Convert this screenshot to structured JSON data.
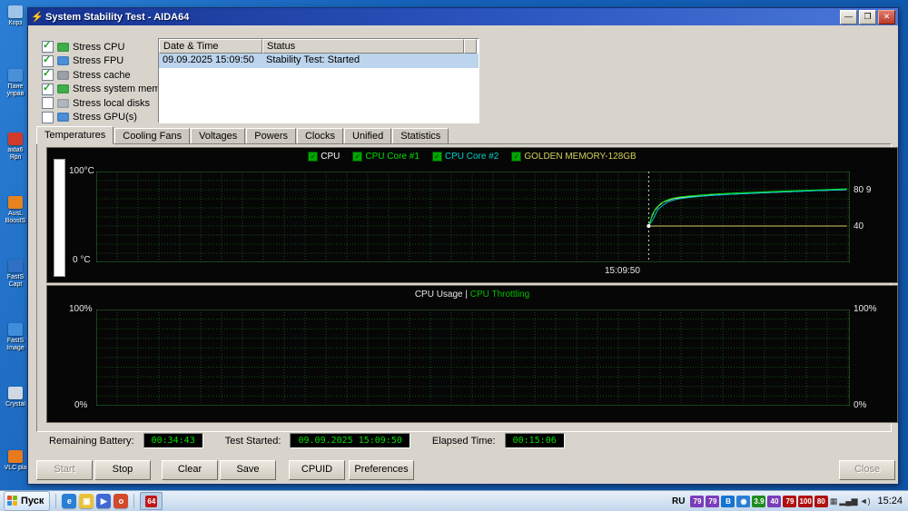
{
  "desktop": {
    "icons": [
      {
        "label": "Корз",
        "color": "#9ec4e8"
      },
      {
        "label": "Пане управ",
        "color": "#4a90d9"
      },
      {
        "label": "aida6 Ярл",
        "color": "#d23a2a"
      },
      {
        "label": "AusL BoostS",
        "color": "#e8821e"
      },
      {
        "label": "FastS Capt",
        "color": "#2f6fc4"
      },
      {
        "label": "FastS Image",
        "color": "#3f8edc"
      },
      {
        "label": "Crystal",
        "color": "#cfd8e4"
      },
      {
        "label": "VLC pla",
        "color": "#e87a1e"
      }
    ]
  },
  "window": {
    "title": "System Stability Test - AIDA64",
    "title_icon": "⚡",
    "minimize": "—",
    "maximize": "❐",
    "close": "✕"
  },
  "stress_options": [
    {
      "label": "Stress CPU",
      "checked": true,
      "icon": "cpu-icon",
      "icon_color": "#3fae49"
    },
    {
      "label": "Stress FPU",
      "checked": true,
      "icon": "fpu-icon",
      "icon_color": "#4a90d9"
    },
    {
      "label": "Stress cache",
      "checked": true,
      "icon": "cache-icon",
      "icon_color": "#9aa0a6"
    },
    {
      "label": "Stress system memory",
      "checked": true,
      "icon": "memory-icon",
      "icon_color": "#3fae49"
    },
    {
      "label": "Stress local disks",
      "checked": false,
      "icon": "disk-icon",
      "icon_color": "#b0b6bc"
    },
    {
      "label": "Stress GPU(s)",
      "checked": false,
      "icon": "gpu-icon",
      "icon_color": "#4a90d9"
    }
  ],
  "event_table": {
    "columns": [
      "Date & Time",
      "Status"
    ],
    "rows": [
      {
        "datetime": "09.09.2025 15:09:50",
        "status": "Stability Test: Started",
        "selected": true
      }
    ]
  },
  "tabs": [
    {
      "label": "Temperatures",
      "active": true
    },
    {
      "label": "Cooling Fans",
      "active": false
    },
    {
      "label": "Voltages",
      "active": false
    },
    {
      "label": "Powers",
      "active": false
    },
    {
      "label": "Clocks",
      "active": false
    },
    {
      "label": "Unified",
      "active": false
    },
    {
      "label": "Statistics",
      "active": false
    }
  ],
  "temperature_chart": {
    "y_top_label": "100°C",
    "y_bottom_label": "0 °C",
    "x_tick_label": "15:09:50",
    "right_labels": [
      {
        "text": "80 9",
        "value": 80
      },
      {
        "text": "40",
        "value": 40
      }
    ],
    "legend": [
      {
        "label": "CPU",
        "color": "#ffffff"
      },
      {
        "label": "CPU Core #1",
        "color": "#00e000"
      },
      {
        "label": "CPU Core #2",
        "color": "#00d2c8"
      },
      {
        "label": "GOLDEN MEMORY-128GB",
        "color": "#d2d25a"
      }
    ],
    "chart_data": {
      "type": "line",
      "ylim": [
        0,
        100
      ],
      "test_start_fraction": 0.733,
      "series": [
        {
          "name": "CPU",
          "color": "#e8e8e8",
          "points": [
            [
              0.733,
              40
            ],
            [
              0.737,
              50
            ],
            [
              0.741,
              57
            ],
            [
              0.746,
              62
            ],
            [
              0.752,
              66
            ],
            [
              0.758,
              68
            ],
            [
              0.765,
              70
            ],
            [
              0.773,
              71
            ],
            [
              0.782,
              72
            ],
            [
              0.792,
              72.5
            ],
            [
              0.803,
              73
            ],
            [
              0.815,
              74
            ],
            [
              0.828,
              74.5
            ],
            [
              0.842,
              75
            ],
            [
              0.856,
              75.5
            ],
            [
              0.87,
              76
            ],
            [
              0.884,
              76.5
            ],
            [
              0.898,
              77
            ],
            [
              0.912,
              77.5
            ],
            [
              0.926,
              78
            ],
            [
              0.94,
              78.5
            ],
            [
              0.954,
              79
            ],
            [
              0.968,
              79.3
            ],
            [
              0.982,
              79.6
            ],
            [
              0.996,
              80
            ]
          ]
        },
        {
          "name": "CPU Core #1",
          "color": "#00dc00",
          "points": [
            [
              0.733,
              40
            ],
            [
              0.738,
              53
            ],
            [
              0.743,
              60
            ],
            [
              0.749,
              65
            ],
            [
              0.756,
              68
            ],
            [
              0.764,
              70.5
            ],
            [
              0.774,
              72
            ],
            [
              0.786,
              73
            ],
            [
              0.8,
              74
            ],
            [
              0.816,
              75
            ],
            [
              0.832,
              75.8
            ],
            [
              0.85,
              76.5
            ],
            [
              0.868,
              77
            ],
            [
              0.886,
              77.6
            ],
            [
              0.904,
              78.2
            ],
            [
              0.922,
              78.8
            ],
            [
              0.94,
              79.3
            ],
            [
              0.958,
              79.8
            ],
            [
              0.976,
              80.4
            ],
            [
              0.996,
              81
            ]
          ]
        },
        {
          "name": "CPU Core #2",
          "color": "#00c8c8",
          "points": [
            [
              0.733,
              40
            ],
            [
              0.739,
              48
            ],
            [
              0.745,
              58
            ],
            [
              0.752,
              63
            ],
            [
              0.76,
              67
            ],
            [
              0.77,
              69.5
            ],
            [
              0.782,
              71
            ],
            [
              0.796,
              72.2
            ],
            [
              0.812,
              73.4
            ],
            [
              0.83,
              74.4
            ],
            [
              0.848,
              75.2
            ],
            [
              0.866,
              76
            ],
            [
              0.884,
              76.6
            ],
            [
              0.902,
              77.2
            ],
            [
              0.92,
              77.8
            ],
            [
              0.938,
              78.4
            ],
            [
              0.956,
              79
            ],
            [
              0.974,
              79.5
            ],
            [
              0.996,
              80
            ]
          ]
        },
        {
          "name": "GOLDEN MEMORY-128GB",
          "color": "#d2d25a",
          "points": [
            [
              0.733,
              40
            ],
            [
              0.996,
              40
            ]
          ]
        }
      ]
    }
  },
  "usage_chart": {
    "header_left": "CPU Usage",
    "header_sep": " | ",
    "header_right": "CPU Throttling",
    "header_right_color": "#00c000",
    "left_top": "100%",
    "left_bottom": "0%",
    "right_top": "100%",
    "right_bottom": "0%",
    "chart_data": {
      "type": "line",
      "ylim": [
        0,
        100
      ],
      "series": []
    }
  },
  "status_items": [
    {
      "label": "Remaining Battery:",
      "value": "00:34:43"
    },
    {
      "label": "Test Started:",
      "value": "09.09.2025 15:09:50"
    },
    {
      "label": "Elapsed Time:",
      "value": "00:15:06"
    }
  ],
  "action_buttons": [
    {
      "label": "Start",
      "enabled": false
    },
    {
      "label": "Stop",
      "enabled": true
    },
    {
      "label": "Clear",
      "enabled": true
    },
    {
      "label": "Save",
      "enabled": true
    },
    {
      "label": "CPUID",
      "enabled": true
    },
    {
      "label": "Preferences",
      "enabled": true
    }
  ],
  "close_button": {
    "label": "Close",
    "enabled": false
  },
  "taskbar": {
    "start_label": "Пуск",
    "quick_launch": [
      {
        "name": "ie-icon",
        "glyph": "e",
        "bg": "#2a7fd4"
      },
      {
        "name": "folder-icon",
        "glyph": "▣",
        "bg": "#e8c23a"
      },
      {
        "name": "media-player-icon",
        "glyph": "▶",
        "bg": "#3f6ad4"
      },
      {
        "name": "browser-icon",
        "glyph": "o",
        "bg": "#d24a2a"
      }
    ],
    "app_button": {
      "label": "64",
      "bg": "#c01818"
    },
    "language": "RU",
    "tray_badges": [
      {
        "text": "79",
        "bg": "#7a3db8"
      },
      {
        "text": "79",
        "bg": "#7a3db8"
      },
      {
        "text": "B",
        "bg": "#1673d2"
      },
      {
        "text": "◉",
        "bg": "#2a7fd4"
      },
      {
        "text": "3.9",
        "bg": "#1f8c1f"
      },
      {
        "text": "40",
        "bg": "#7a3db8"
      },
      {
        "text": "79",
        "bg": "#b01010"
      },
      {
        "text": "100",
        "bg": "#b01010"
      },
      {
        "text": "80",
        "bg": "#b01010"
      }
    ],
    "tray_icons": [
      {
        "name": "chart-icon",
        "glyph": "▦"
      },
      {
        "name": "network-icon",
        "glyph": "▂▄▆"
      },
      {
        "name": "volume-icon",
        "glyph": "◄)"
      }
    ],
    "clock": "15:24"
  }
}
